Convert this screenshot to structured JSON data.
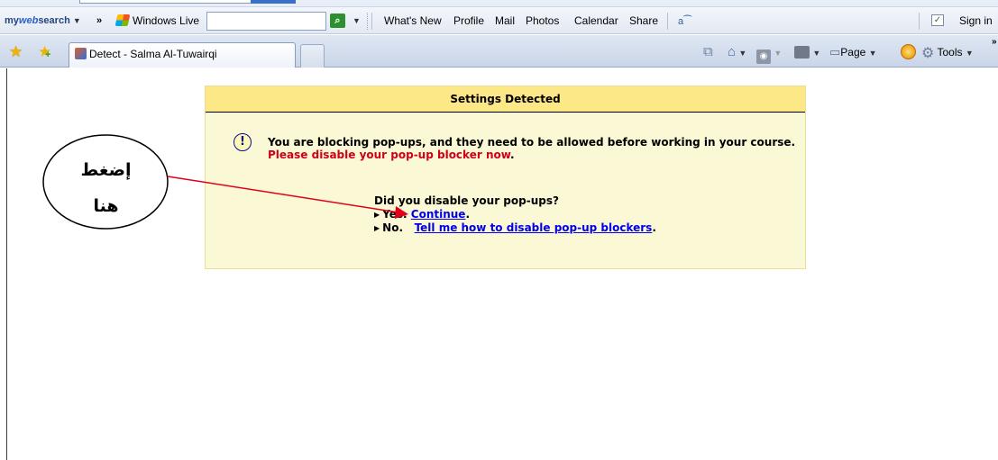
{
  "browser": {
    "links_bar": {
      "mywebsearch_prefix": "my",
      "mywebsearch_brand": "web",
      "mywebsearch_suffix": "search",
      "overflow_chevron": "»",
      "windows_live_label": "Windows Live",
      "search_value": "",
      "links": [
        "What's New",
        "Profile",
        "Mail",
        "Photos",
        "Calendar",
        "Share"
      ],
      "sign_in_label": "Sign in"
    },
    "tab": {
      "title": "Detect - Salma Al-Tuwairqi"
    },
    "command_bar": {
      "page_label": "Page",
      "tools_label": "Tools"
    }
  },
  "dialog": {
    "header": "Settings Detected",
    "warning_message": "You are blocking pop-ups, and they need to be allowed before working in your course.",
    "action_message": "Please disable your pop-up blocker now",
    "question": "Did you disable your pop-ups?",
    "yes_prefix": "Yes.",
    "yes_link": "Continue",
    "no_prefix": "No.",
    "no_link": "Tell me how to disable pop-up blockers"
  },
  "annotation": {
    "callout_text": "إضغط هنا",
    "arrow_color": "#e0001a"
  }
}
